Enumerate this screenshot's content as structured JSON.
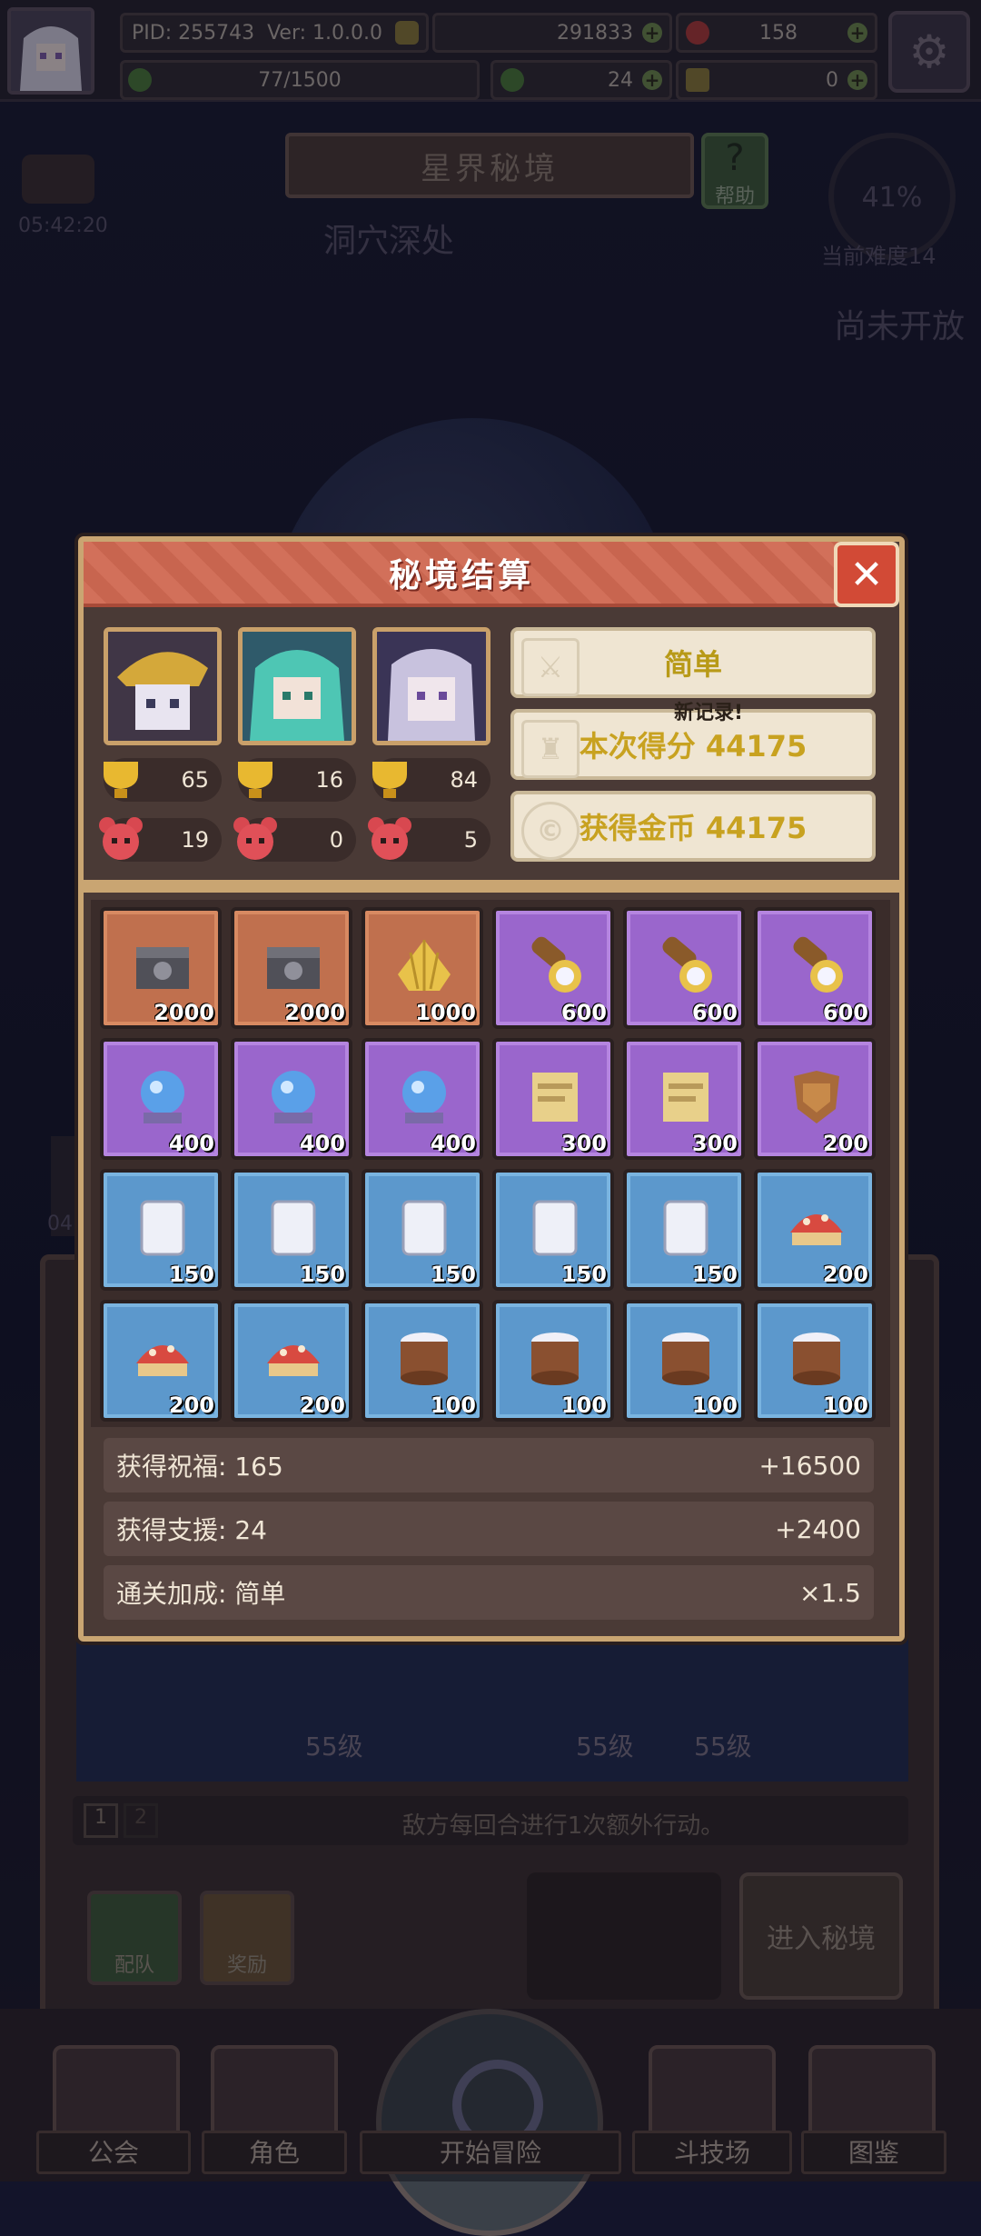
{
  "topbar": {
    "pid": "PID: 255743",
    "version": "Ver: 1.0.0.0",
    "gold": "291833",
    "gems": "158",
    "exp": "77/1500",
    "clovers": "24",
    "keys": "0"
  },
  "background": {
    "area_title": "星界秘境",
    "help_label": "帮助",
    "timer": "05:42:20",
    "cave_label": "洞穴深处",
    "progress": "41%",
    "difficulty": "当前难度14",
    "not_open": "尚未开放",
    "left_timer": "04",
    "level_a": "55级",
    "level_b": "55级",
    "level_c": "55级",
    "page_1": "1",
    "page_2": "2",
    "enemy_note": "敌方每回合进行1次额外行动。",
    "team_label": "配队",
    "reward_label": "奖励",
    "enter_label": "进入秘境"
  },
  "nav": {
    "guild": "公会",
    "role": "角色",
    "adventure": "开始冒险",
    "arena": "斗技场",
    "codex": "图鉴"
  },
  "dialog": {
    "title": "秘境结算",
    "heroes": [
      {
        "level": "65",
        "count": "19"
      },
      {
        "level": "16",
        "count": "0"
      },
      {
        "level": "84",
        "count": "5"
      }
    ],
    "difficulty": "简单",
    "new_record": "新记录!",
    "score": "本次得分 44175",
    "coins": "获得金币 44175",
    "rewards": [
      {
        "qty": "2000",
        "rarity": "orange",
        "icon": "chest-icon"
      },
      {
        "qty": "2000",
        "rarity": "orange",
        "icon": "chest-icon"
      },
      {
        "qty": "1000",
        "rarity": "orange",
        "icon": "shell-icon"
      },
      {
        "qty": "600",
        "rarity": "purple",
        "icon": "telescope-icon"
      },
      {
        "qty": "600",
        "rarity": "purple",
        "icon": "telescope-icon"
      },
      {
        "qty": "600",
        "rarity": "purple",
        "icon": "telescope-icon"
      },
      {
        "qty": "400",
        "rarity": "purple",
        "icon": "crystal-ball-icon"
      },
      {
        "qty": "400",
        "rarity": "purple",
        "icon": "crystal-ball-icon"
      },
      {
        "qty": "400",
        "rarity": "purple",
        "icon": "crystal-ball-icon"
      },
      {
        "qty": "300",
        "rarity": "purple",
        "icon": "scroll-icon"
      },
      {
        "qty": "300",
        "rarity": "purple",
        "icon": "scroll-icon"
      },
      {
        "qty": "200",
        "rarity": "purple",
        "icon": "armor-icon"
      },
      {
        "qty": "150",
        "rarity": "blue",
        "icon": "tablet-icon"
      },
      {
        "qty": "150",
        "rarity": "blue",
        "icon": "tablet-icon"
      },
      {
        "qty": "150",
        "rarity": "blue",
        "icon": "tablet-icon"
      },
      {
        "qty": "150",
        "rarity": "blue",
        "icon": "tablet-icon"
      },
      {
        "qty": "150",
        "rarity": "blue",
        "icon": "tablet-icon"
      },
      {
        "qty": "200",
        "rarity": "blue",
        "icon": "mushroom-icon"
      },
      {
        "qty": "200",
        "rarity": "blue",
        "icon": "mushroom-icon"
      },
      {
        "qty": "200",
        "rarity": "blue",
        "icon": "mushroom-icon"
      },
      {
        "qty": "100",
        "rarity": "blue",
        "icon": "drum-icon"
      },
      {
        "qty": "100",
        "rarity": "blue",
        "icon": "drum-icon"
      },
      {
        "qty": "100",
        "rarity": "blue",
        "icon": "drum-icon"
      },
      {
        "qty": "100",
        "rarity": "blue",
        "icon": "drum-icon"
      }
    ],
    "summary": [
      {
        "label": "获得祝福: 165",
        "value": "+16500"
      },
      {
        "label": "获得支援: 24",
        "value": "+2400"
      },
      {
        "label": "通关加成: 简单",
        "value": "×1.5"
      }
    ]
  }
}
